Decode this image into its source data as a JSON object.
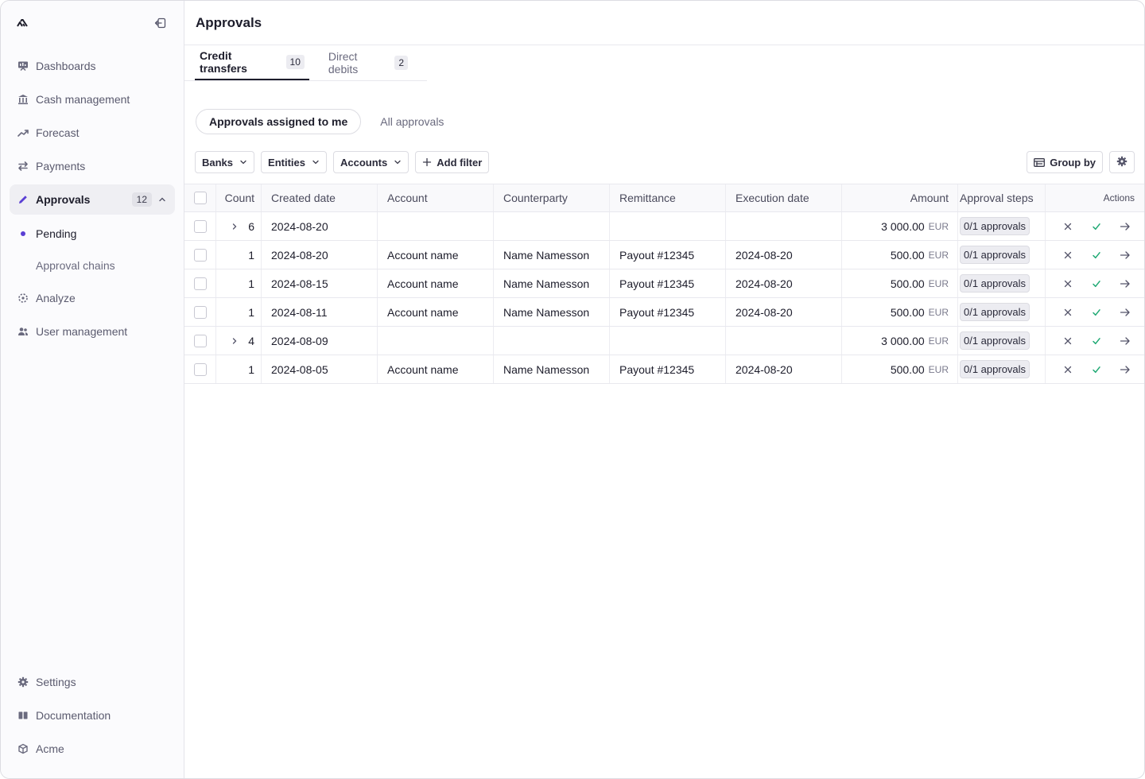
{
  "sidebar": {
    "nav": [
      {
        "label": "Dashboards",
        "icon": "dashboard-icon"
      },
      {
        "label": "Cash management",
        "icon": "bank-icon"
      },
      {
        "label": "Forecast",
        "icon": "trend-up-icon"
      },
      {
        "label": "Payments",
        "icon": "swap-arrows-icon"
      },
      {
        "label": "Approvals",
        "icon": "pencil-icon",
        "badge": "12"
      }
    ],
    "sub": [
      {
        "label": "Pending"
      },
      {
        "label": "Approval chains"
      }
    ],
    "nav2": [
      {
        "label": "Analyze",
        "icon": "analyze-icon"
      },
      {
        "label": "User management",
        "icon": "users-icon"
      }
    ],
    "bottom": [
      {
        "label": "Settings",
        "icon": "gear-icon"
      },
      {
        "label": "Documentation",
        "icon": "book-icon"
      },
      {
        "label": "Acme",
        "icon": "org-icon"
      }
    ]
  },
  "header": {
    "title": "Approvals"
  },
  "tabs": [
    {
      "label": "Credit transfers",
      "count": "10"
    },
    {
      "label": "Direct debits",
      "count": "2"
    }
  ],
  "segments": [
    "Approvals assigned to me",
    "All approvals"
  ],
  "filters": {
    "banks": "Banks",
    "entities": "Entities",
    "accounts": "Accounts",
    "add": "Add filter",
    "group_by": "Group by"
  },
  "table": {
    "headers": {
      "count": "Count",
      "created": "Created date",
      "account": "Account",
      "counterparty": "Counterparty",
      "remittance": "Remittance",
      "execution": "Execution date",
      "amount": "Amount",
      "steps": "Approval steps",
      "actions": "Actions"
    },
    "rows": [
      {
        "group": true,
        "count": "6",
        "created": "2024-08-20",
        "account": "",
        "counterparty": "",
        "remittance": "",
        "execution": "",
        "amount": "3 000.00",
        "currency": "EUR",
        "steps": "0/1 approvals"
      },
      {
        "group": false,
        "count": "1",
        "created": "2024-08-20",
        "account": "Account name",
        "counterparty": "Name Namesson",
        "remittance": "Payout #12345",
        "execution": "2024-08-20",
        "amount": "500.00",
        "currency": "EUR",
        "steps": "0/1 approvals"
      },
      {
        "group": false,
        "count": "1",
        "created": "2024-08-15",
        "account": "Account name",
        "counterparty": "Name Namesson",
        "remittance": "Payout #12345",
        "execution": "2024-08-20",
        "amount": "500.00",
        "currency": "EUR",
        "steps": "0/1 approvals"
      },
      {
        "group": false,
        "count": "1",
        "created": "2024-08-11",
        "account": "Account name",
        "counterparty": "Name Namesson",
        "remittance": "Payout #12345",
        "execution": "2024-08-20",
        "amount": "500.00",
        "currency": "EUR",
        "steps": "0/1 approvals"
      },
      {
        "group": true,
        "count": "4",
        "created": "2024-08-09",
        "account": "",
        "counterparty": "",
        "remittance": "",
        "execution": "",
        "amount": "3 000.00",
        "currency": "EUR",
        "steps": "0/1 approvals"
      },
      {
        "group": false,
        "count": "1",
        "created": "2024-08-05",
        "account": "Account name",
        "counterparty": "Name Namesson",
        "remittance": "Payout #12345",
        "execution": "2024-08-20",
        "amount": "500.00",
        "currency": "EUR",
        "steps": "0/1 approvals"
      }
    ]
  },
  "colors": {
    "accent": "#5a3fd4",
    "approve": "#1fa974",
    "text": "#1d1d2b"
  }
}
